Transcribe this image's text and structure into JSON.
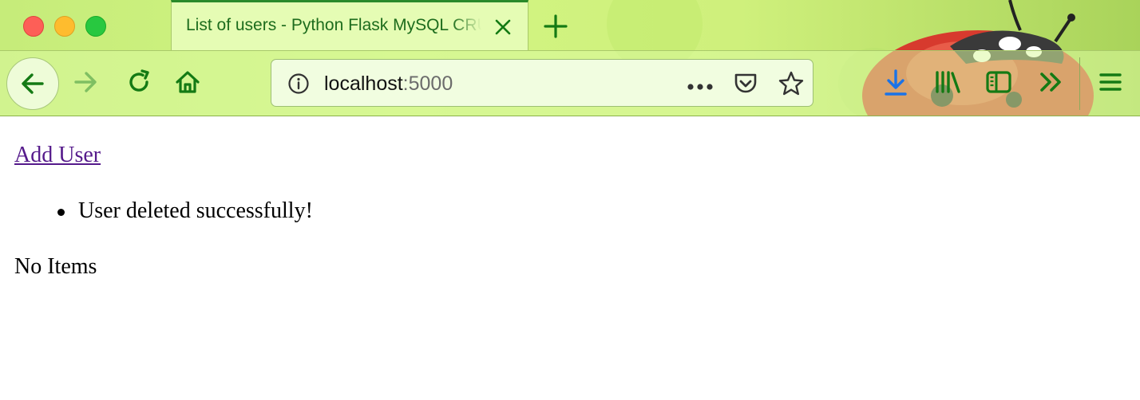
{
  "browser": {
    "tab": {
      "title": "List of users - Python Flask MySQL CRUD"
    },
    "url": {
      "host": "localhost",
      "port": ":5000"
    },
    "icons": {
      "close": "close-icon",
      "new_tab": "plus-icon",
      "back": "arrow-left-icon",
      "forward": "arrow-right-icon",
      "reload": "reload-icon",
      "home": "home-icon",
      "info": "info-icon",
      "page_actions": "more-icon",
      "pocket": "pocket-icon",
      "bookmark": "star-icon",
      "downloads": "download-icon",
      "library": "library-icon",
      "sidebar": "sidebar-icon",
      "overflow": "chevrons-right-icon",
      "menu": "hamburger-menu-icon"
    },
    "colors": {
      "toolbar_icon": "#147a14",
      "download_icon": "#1a73e8",
      "link_visited": "#551a8b"
    }
  },
  "page": {
    "add_user_link": "Add User",
    "flash_messages": [
      "User deleted successfully!"
    ],
    "empty_text": "No Items"
  }
}
